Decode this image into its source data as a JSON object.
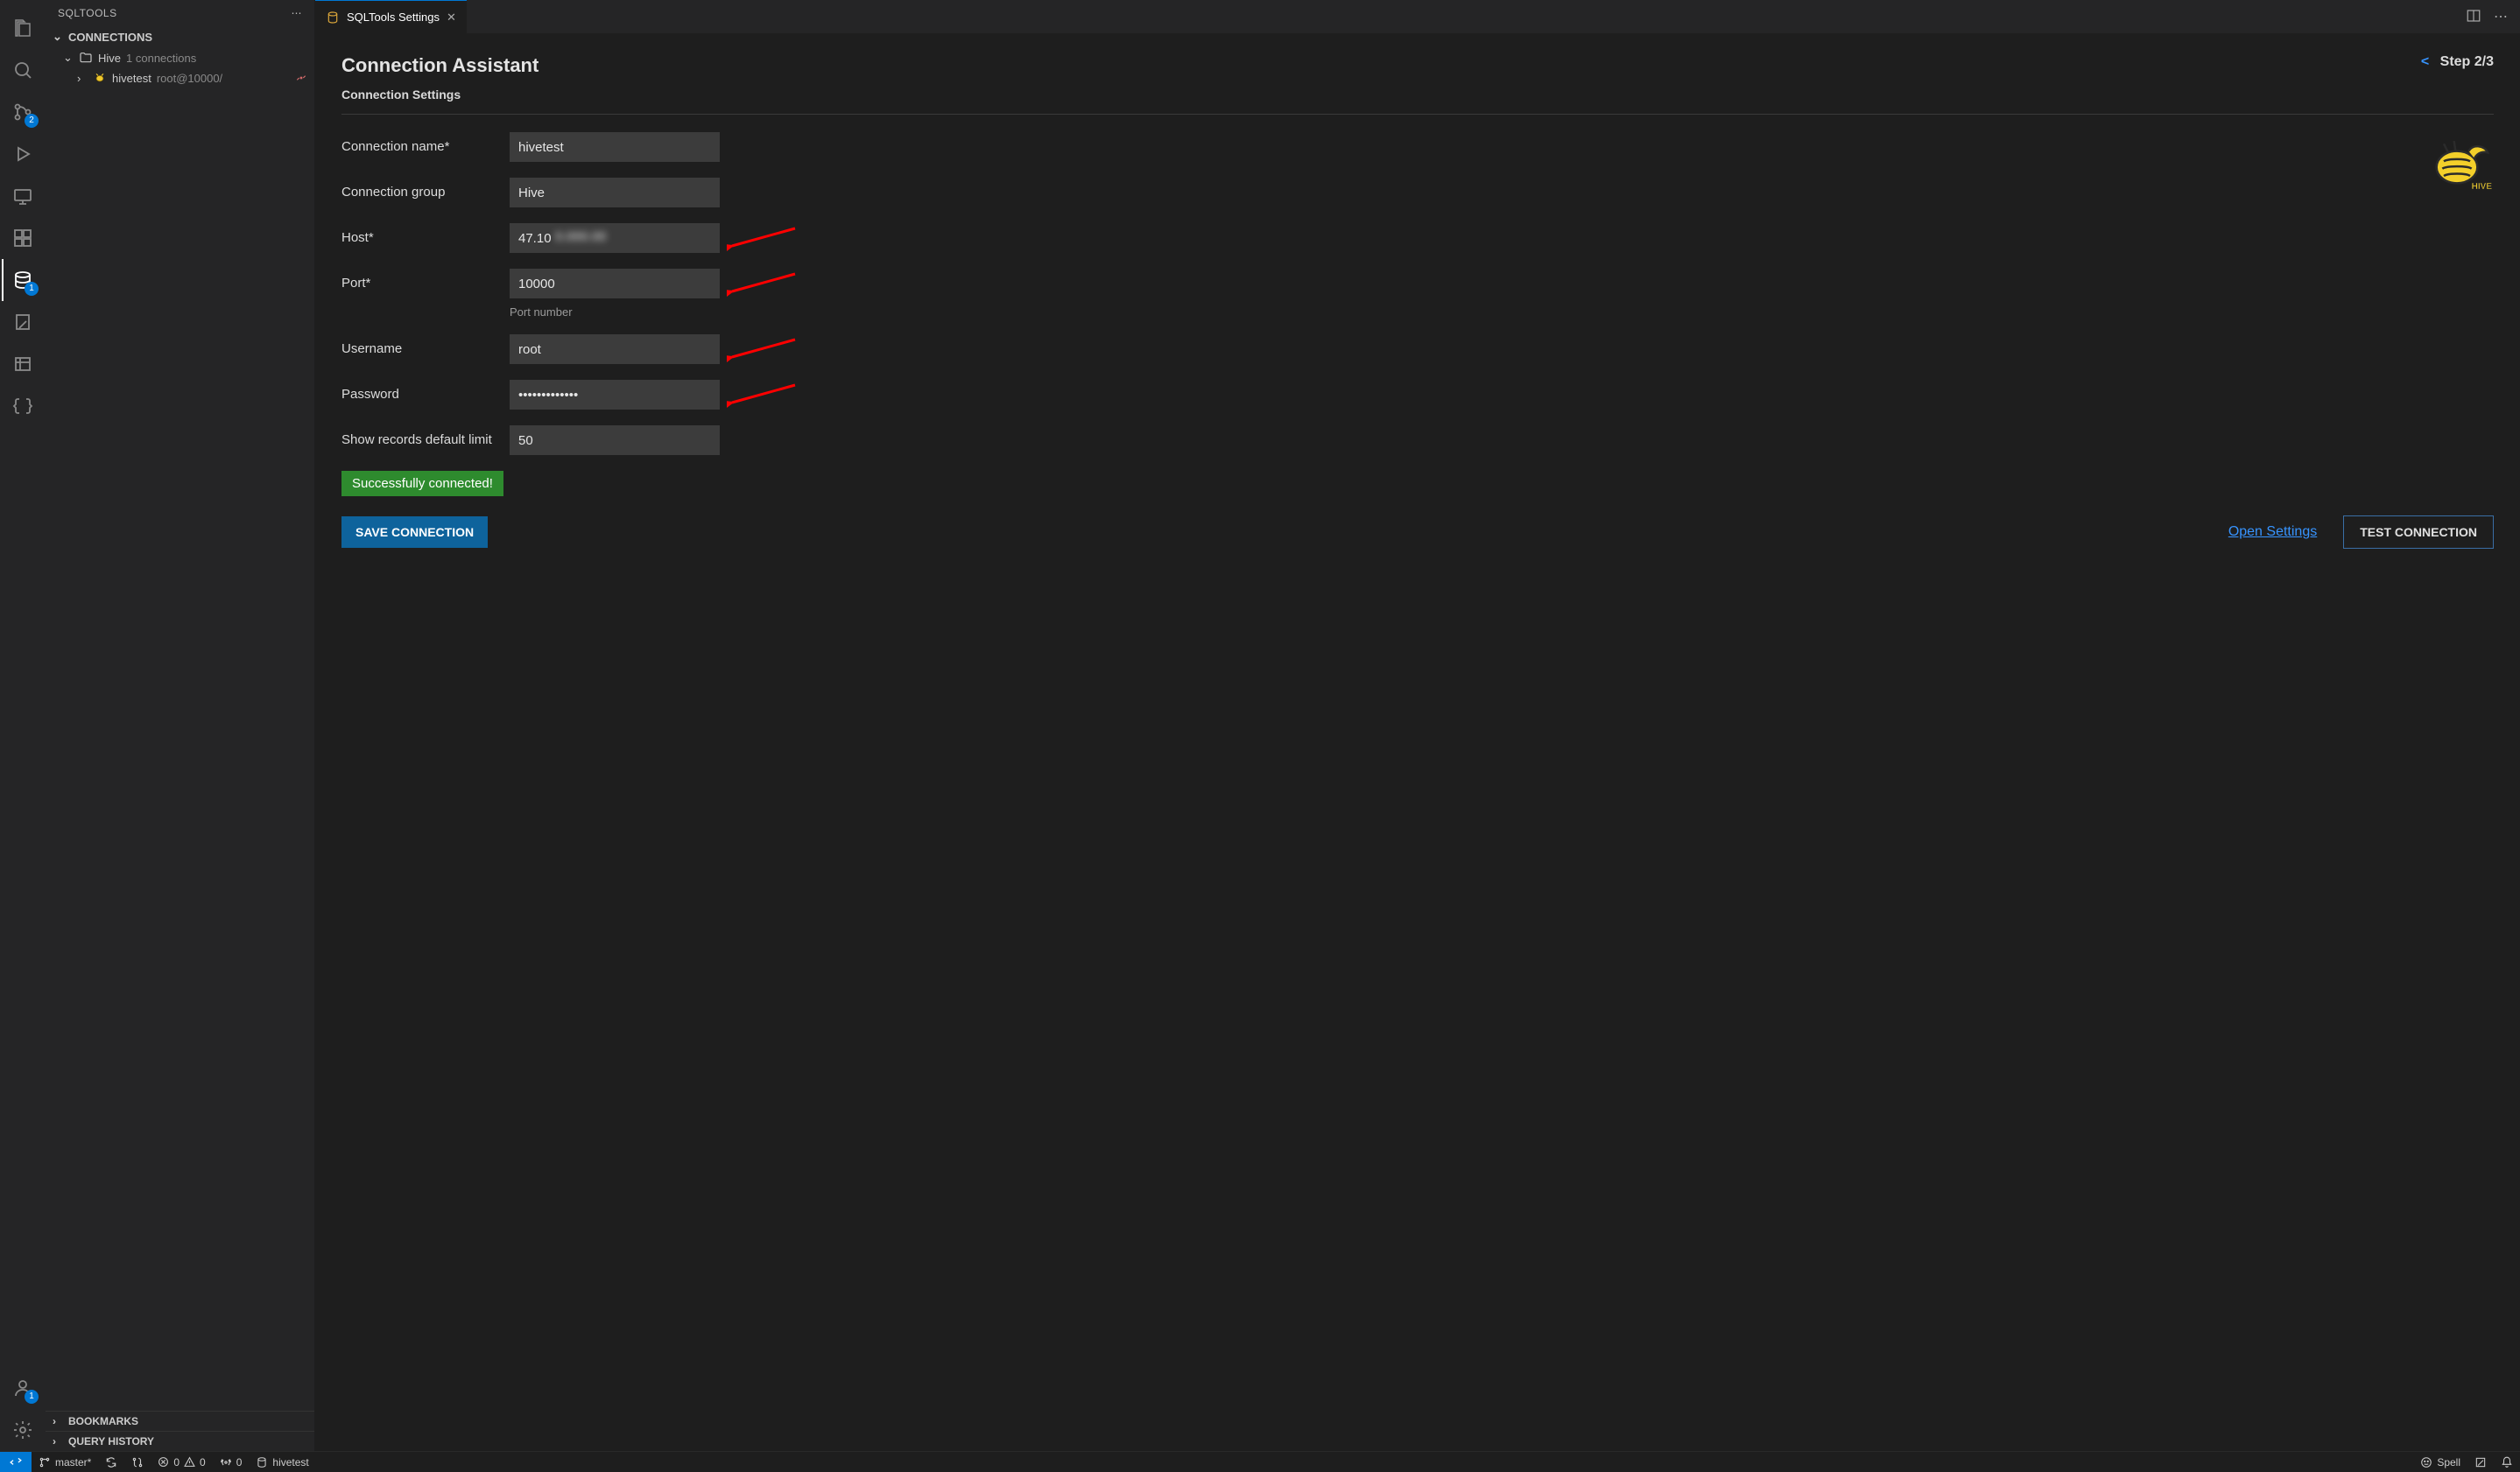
{
  "sidebar": {
    "title": "SQLTOOLS",
    "sections": {
      "connections": "CONNECTIONS",
      "bookmarks": "BOOKMARKS",
      "query_history": "QUERY HISTORY"
    },
    "group": {
      "name": "Hive",
      "count": "1 connections"
    },
    "conn": {
      "name": "hivetest",
      "detail": "root@10000/"
    },
    "badges": {
      "scm": "2",
      "db": "1",
      "account": "1"
    }
  },
  "tab": {
    "title": "SQLTools Settings"
  },
  "page": {
    "title": "Connection Assistant",
    "subtitle": "Connection Settings",
    "step_back": "<",
    "step": "Step 2/3"
  },
  "form": {
    "labels": {
      "name": "Connection name*",
      "group": "Connection group",
      "host": "Host*",
      "port": "Port*",
      "port_hint": "Port number",
      "username": "Username",
      "password": "Password",
      "limit": "Show records default limit"
    },
    "values": {
      "name": "hivetest",
      "group": "Hive",
      "host_visible": "47.10",
      "host_obscured": "0.000.00",
      "port": "10000",
      "username": "root",
      "password": "•••••••••••••",
      "limit": "50"
    },
    "success": "Successfully connected!",
    "buttons": {
      "save": "SAVE CONNECTION",
      "open_settings": "Open Settings",
      "test": "TEST CONNECTION"
    }
  },
  "statusbar": {
    "branch": "master*",
    "errors": "0",
    "warnings": "0",
    "ports": "0",
    "conn": "hivetest",
    "spell": "Spell"
  },
  "icons": {
    "folder": "📁",
    "bee": "🐝"
  }
}
